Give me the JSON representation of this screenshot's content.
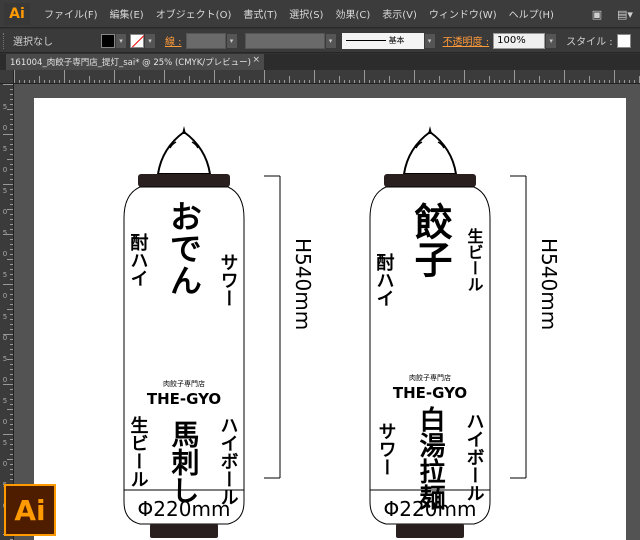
{
  "app": {
    "badge": "Ai",
    "menu": [
      "ファイル(F)",
      "編集(E)",
      "オブジェクト(O)",
      "書式(T)",
      "選択(S)",
      "効果(C)",
      "表示(V)",
      "ウィンドウ(W)",
      "ヘルプ(H)"
    ]
  },
  "control_bar": {
    "selection": "選択なし",
    "stroke_label": "線 :",
    "brush": "基本",
    "opacity_label": "不透明度 :",
    "opacity_value": "100%",
    "style_label": "スタイル :"
  },
  "document": {
    "tab_title": "161004_肉餃子専門店_提灯_sai* @ 25% (CMYK/プレビュー)",
    "close": "×"
  },
  "ruler_left_digits": [
    "5",
    "0",
    "5",
    "0",
    "5",
    "0",
    "5",
    "0",
    "5",
    "0",
    "5",
    "0",
    "5",
    "0",
    "5",
    "0",
    "5",
    "0",
    "5",
    "0"
  ],
  "lanterns": [
    {
      "columns": [
        {
          "text": "酎ハイ"
        },
        {
          "text": "おでん"
        },
        {
          "text": "サワー"
        }
      ],
      "brand_small": "肉餃子専門店",
      "brand": "THE-GYO",
      "bottom_columns": [
        {
          "text": "生ビール"
        },
        {
          "text": "馬刺し"
        },
        {
          "text": "ハイボール"
        }
      ],
      "height_label": "H540mm",
      "width_label": "Φ220mm"
    },
    {
      "columns": [
        {
          "text": "酎ハイ"
        },
        {
          "text": "餃子"
        },
        {
          "text": "生ビール"
        }
      ],
      "brand_small": "肉餃子専門店",
      "brand": "THE-GYO",
      "bottom_columns": [
        {
          "text": "サワー"
        },
        {
          "text": "白湯拉麺"
        },
        {
          "text": "ハイボール"
        }
      ],
      "height_label": "H540mm",
      "width_label": "Φ220mm"
    }
  ],
  "logo": "Ai"
}
